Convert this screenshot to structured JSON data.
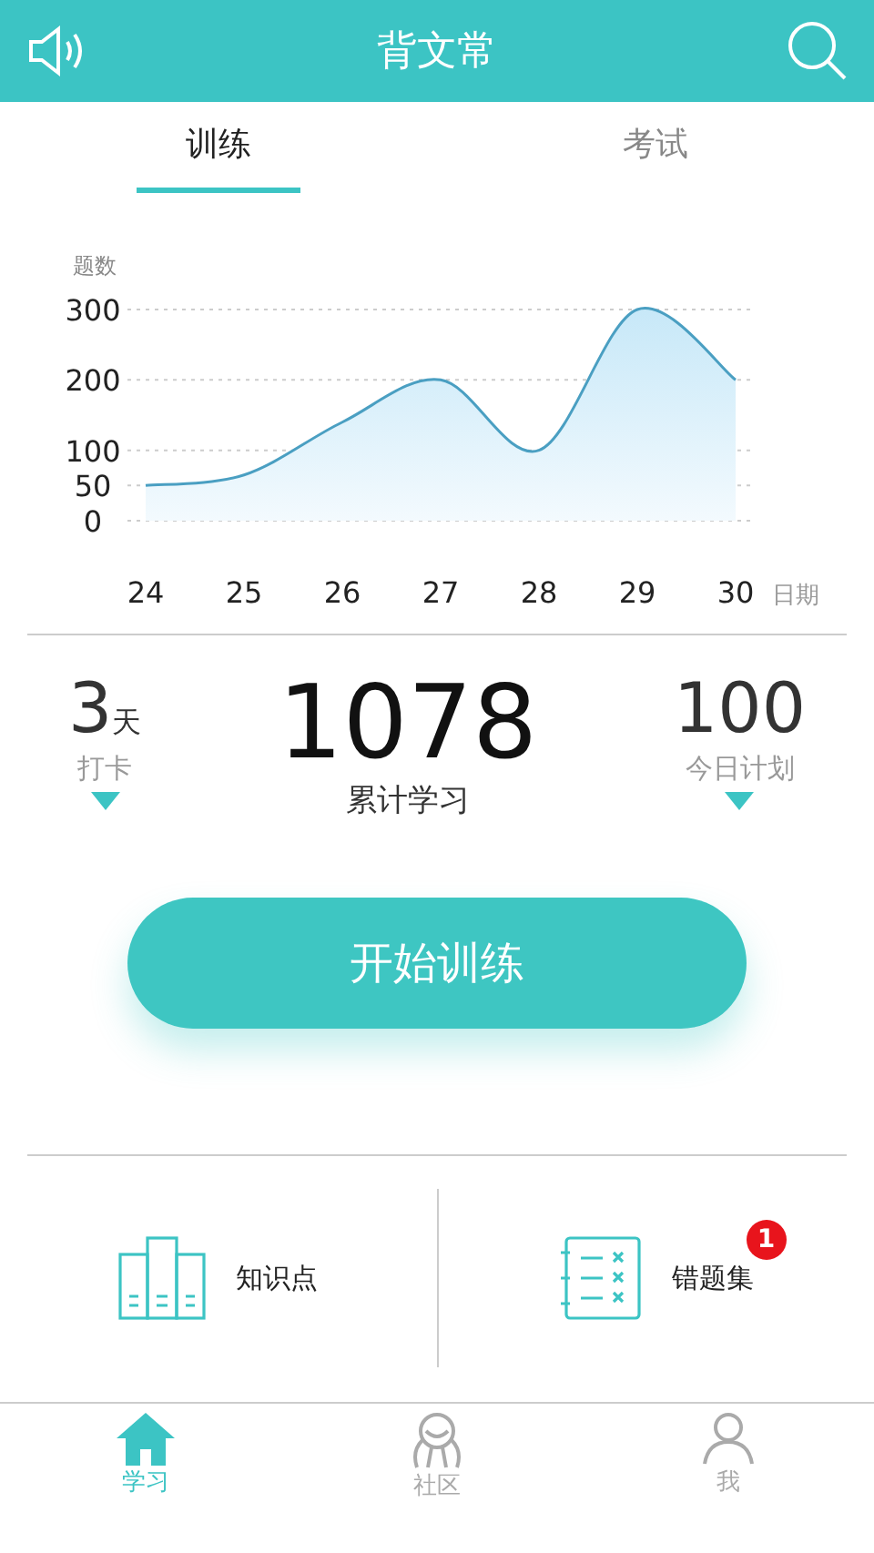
{
  "header": {
    "title": "背文常"
  },
  "tabs": [
    {
      "label": "训练",
      "selected": true
    },
    {
      "label": "考试",
      "selected": false
    }
  ],
  "chart_data": {
    "type": "area",
    "ylabel": "题数",
    "xlabel": "日期",
    "categories": [
      "24",
      "25",
      "26",
      "27",
      "28",
      "29",
      "30"
    ],
    "series": [
      {
        "color": "#4a9fc2",
        "values": [
          50,
          65,
          140,
          200,
          100,
          300,
          200
        ]
      }
    ],
    "ylim": [
      0,
      300
    ],
    "grid": true,
    "yticks": [
      0,
      50,
      100,
      200,
      300
    ]
  },
  "stats": [
    {
      "kind": "side",
      "value": "3",
      "unit": "天",
      "label": "打卡",
      "dropdown": true
    },
    {
      "kind": "main",
      "value": "1078",
      "label": "累计学习",
      "dropdown": false
    },
    {
      "kind": "side",
      "value": "100",
      "label": "今日计划",
      "dropdown": true
    }
  ],
  "start_button": "开始训练",
  "shortcuts": [
    {
      "kind": "knowledge",
      "label": "知识点"
    },
    {
      "kind": "mistakes",
      "label": "错题集",
      "badge": "1"
    }
  ],
  "tab_bar": [
    {
      "kind": "home",
      "label": "学习",
      "selected": true
    },
    {
      "kind": "community",
      "label": "社区",
      "selected": false
    },
    {
      "kind": "me",
      "label": "我",
      "selected": false
    }
  ]
}
